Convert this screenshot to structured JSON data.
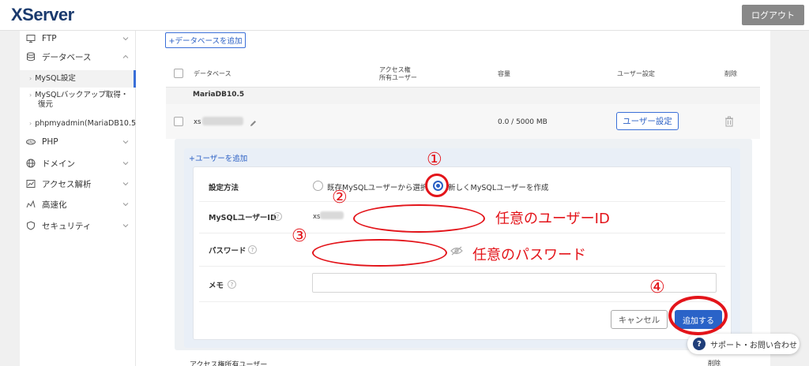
{
  "header": {
    "logo": "XServer",
    "logout": "ログアウト"
  },
  "sidebar": {
    "items": [
      {
        "label": "FTP",
        "icon": "monitor-icon"
      },
      {
        "label": "データベース",
        "icon": "database-icon"
      },
      {
        "label": "PHP",
        "icon": "php-icon"
      },
      {
        "label": "ドメイン",
        "icon": "globe-icon"
      },
      {
        "label": "アクセス解析",
        "icon": "analytics-icon"
      },
      {
        "label": "高速化",
        "icon": "speed-icon"
      },
      {
        "label": "セキュリティ",
        "icon": "shield-icon"
      }
    ],
    "subitems": [
      {
        "label": "MySQL設定"
      },
      {
        "label": "MySQLバックアップ取得・"
      },
      {
        "label": "復元"
      },
      {
        "label": "phpmyadmin(MariaDB10.5)"
      }
    ]
  },
  "main": {
    "add_db_button": "+データベースを追加",
    "table": {
      "headers": {
        "database": "データベース",
        "access_line1": "アクセス権",
        "access_line2": "所有ユーザー",
        "capacity": "容量",
        "user_settings": "ユーザー設定",
        "delete": "削除"
      },
      "group": "MariaDB10.5",
      "row": {
        "db_prefix": "xs",
        "capacity": "0.0 / 5000 MB",
        "user_settings_button": "ユーザー設定"
      }
    },
    "add_user": {
      "link": "+ユーザーを追加",
      "setting_method_label": "設定方法",
      "option_existing": "既存MySQLユーザーから選択",
      "option_new": "新しくMySQLユーザーを作成",
      "selected": "new",
      "mysql_user_id_label": "MySQLユーザーID",
      "user_id_prefix": "xs",
      "password_label": "パスワード",
      "memo_label": "メモ",
      "cancel_button": "キャンセル",
      "add_button": "追加する"
    },
    "bottom_header": {
      "access": "アクセス権所有ユーザー",
      "delete": "削除"
    }
  },
  "annotations": {
    "n1": "①",
    "n2": "②",
    "n3": "③",
    "n4": "④",
    "user_id_note": "任意のユーザーID",
    "password_note": "任意のパスワード",
    "color": "#e3141a"
  },
  "support": {
    "label": "サポート・お問い合わせ",
    "icon": "question-icon"
  }
}
